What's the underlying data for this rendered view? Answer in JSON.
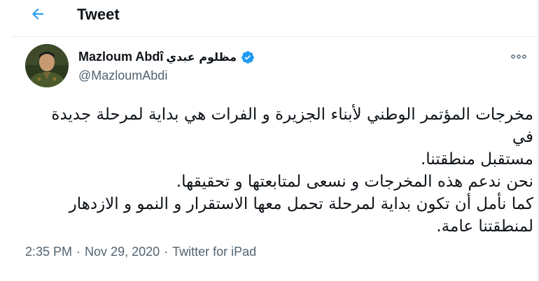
{
  "header": {
    "back_icon": "arrow-left-icon",
    "title": "Tweet"
  },
  "author": {
    "display_name_latin": "Mazloum Abdî",
    "display_name_arabic": "مظلوم عبدي",
    "verified_icon": "verified-badge-icon",
    "handle": "@MazloumAbdi",
    "avatar_icon": "user-avatar"
  },
  "more_icon": "more-dots-icon",
  "tweet": {
    "lines": [
      "مخرجات المؤتمر الوطني لأبناء الجزيرة و الفرات هي بداية لمرحلة جديدة في",
      "مستقبل منطقتنا.",
      "نحن ندعم هذه المخرجات و نسعى لمتابعتها و تحقيقها.",
      "كما نأمل أن تكون بداية لمرحلة تحمل معها الاستقرار و النمو و الازدهار",
      "لمنطقتنا عامة."
    ]
  },
  "meta": {
    "time": "2:35 PM",
    "separator": "·",
    "date": "Nov 29, 2020",
    "source": "Twitter for iPad"
  },
  "colors": {
    "accent": "#1d9bf0",
    "text": "#0f1419",
    "secondary": "#536471",
    "divider": "#e6ecf0"
  }
}
